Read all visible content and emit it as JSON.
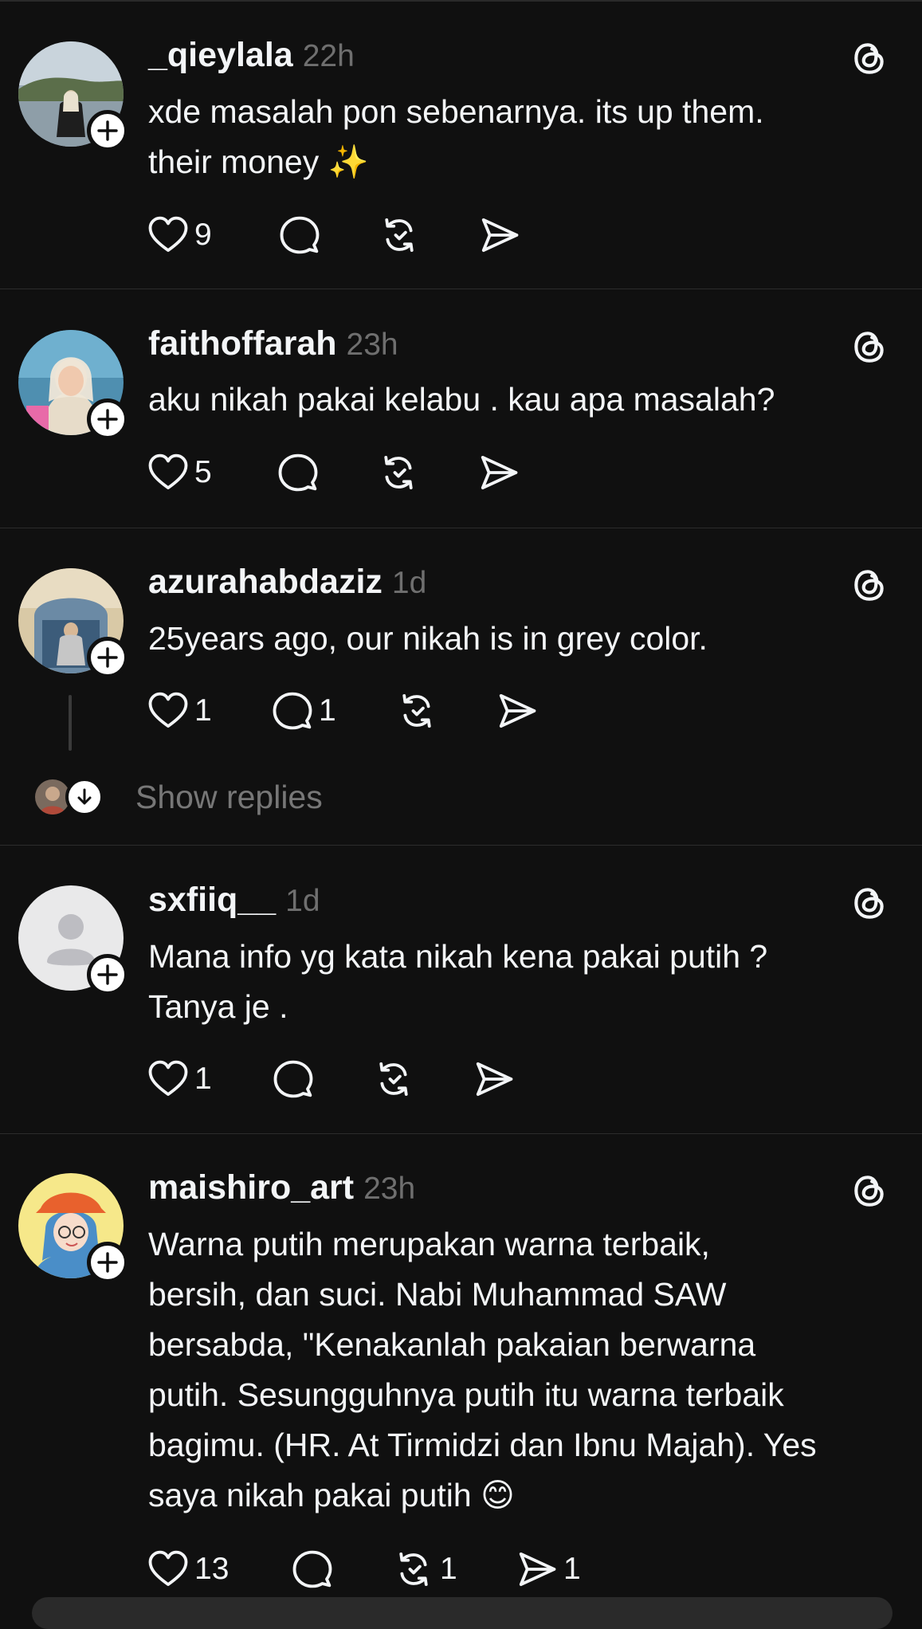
{
  "posts": [
    {
      "username": "_qieylala",
      "time": "22h",
      "text": "xde masalah pon sebenarnya. its up them.\ntheir money ✨",
      "likes": "9",
      "replies": "",
      "reposts": "",
      "shares": ""
    },
    {
      "username": "faithoffarah",
      "time": "23h",
      "text": "aku nikah pakai kelabu . kau apa masalah?",
      "likes": "5",
      "replies": "",
      "reposts": "",
      "shares": ""
    },
    {
      "username": "azurahabdaziz",
      "time": "1d",
      "text": "25years ago, our nikah is in grey color.",
      "likes": "1",
      "replies": "1",
      "reposts": "",
      "shares": "",
      "show_replies": "Show replies"
    },
    {
      "username": "sxfiiq__",
      "time": "1d",
      "text": "Mana info yg kata nikah kena pakai putih ?\nTanya je .",
      "likes": "1",
      "replies": "",
      "reposts": "",
      "shares": ""
    },
    {
      "username": "maishiro_art",
      "time": "23h",
      "text": "Warna putih merupakan warna terbaik,\nbersih, dan suci. Nabi Muhammad SAW\nbersabda, \"Kenakanlah pakaian berwarna\nputih. Sesungguhnya putih itu warna terbaik\nbagimu. (HR. At Tirmidzi dan Ibnu Majah). Yes\nsaya nikah pakai putih 😊",
      "likes": "13",
      "replies": "",
      "reposts": "1",
      "shares": "1"
    }
  ],
  "colors": {
    "background": "#101010",
    "text": "#f3f5f7",
    "muted": "#6f6f6f",
    "separator": "#2c2c2c"
  },
  "icons": [
    "heart-icon",
    "comment-icon",
    "repost-icon",
    "share-icon",
    "threads-logo-icon",
    "plus-icon",
    "arrow-down-icon",
    "default-avatar-icon"
  ]
}
